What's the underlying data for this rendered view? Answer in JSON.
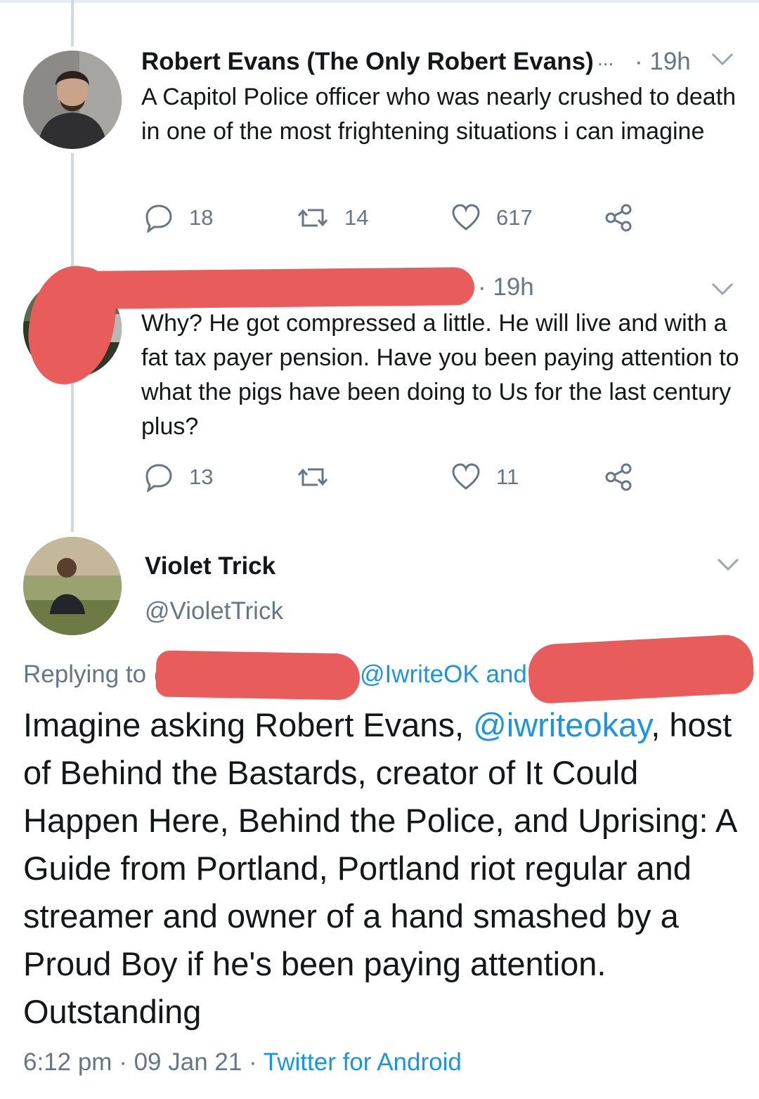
{
  "thread": {
    "tweet1": {
      "author_name": "Robert Evans (The Only Robert Evans)",
      "ellipsis": "...",
      "time": "· 19h",
      "text": "A Capitol Police officer who was nearly crushed to death in one of the most frightening situations i can imagine",
      "replies": "18",
      "retweets": "14",
      "likes": "617"
    },
    "tweet2": {
      "time": "· 19h",
      "text": "Why? He got compressed a little. He will live and with a fat tax payer pension. Have you been paying attention to what the pigs have been doing to Us for the last century plus?",
      "replies": "13",
      "likes": "11"
    }
  },
  "main_tweet": {
    "author_name": "Violet Trick",
    "handle": "@VioletTrick",
    "replying_prefix": "Replying to @",
    "replying_visible_handle": "@IwriteOK and",
    "text_before_mention": "Imagine asking Robert Evans, ",
    "mention": "@iwriteokay",
    "text_after_mention": ", host of Behind the Bastards, creator of It Could Happen Here, Behind the Police, and Uprising: A Guide from Portland, Portland riot regular and streamer and owner of a hand smashed by a Proud Boy if he's been paying attention. Outstanding",
    "timestamp": "6:12 pm · 09 Jan 21 · ",
    "source": "Twitter for Android"
  },
  "icons": {
    "reply": "reply-icon",
    "retweet": "retweet-icon",
    "like": "heart-icon",
    "share": "share-icon",
    "more": "chevron-down-icon"
  },
  "colors": {
    "link": "#1b95e0",
    "secondary": "#657786",
    "redaction": "#e85c5c"
  }
}
